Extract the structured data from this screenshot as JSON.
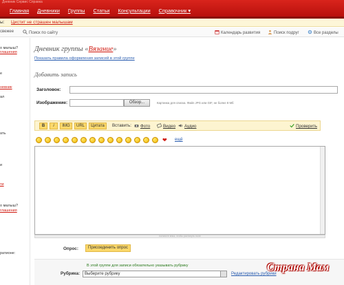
{
  "topnav": {
    "sub_text": "Дневник   Сервис   Справка",
    "items": [
      "Главная",
      "Дневники",
      "Группы",
      "Статьи",
      "Консультации"
    ],
    "dropdown": "Справочник"
  },
  "promo": {
    "left": "ы:",
    "text": "Цистит не страшен малышам"
  },
  "toolbar": {
    "left": "свежее",
    "search": "Поиск по сайту",
    "calendar": "Календарь развития",
    "friends": "Поиск подруг",
    "sections": "Все разделы"
  },
  "sidebar": {
    "t1": "о малыш?",
    "l1": "глашения",
    "t2": "е",
    "l2": "невник",
    "t3": "ал",
    "t4": "ать",
    "t5": "и",
    "l3": "ти",
    "t6": "о малыш?",
    "l4": "глашения",
    "t7": "ратионе:"
  },
  "page": {
    "title_prefix": "Дневник группы «",
    "group": "Вязание",
    "title_suffix": "»",
    "rules_link": "Показать правила оформления записей в этой группе",
    "add_heading": "Добавить запись"
  },
  "form": {
    "title_label": "Заголовок:",
    "image_label": "Изображение:",
    "browse": "Обзор...",
    "image_hint": "Картинка для списка. Файл JPG или GIF, не более 8 Мб"
  },
  "editor": {
    "bold": "B",
    "italic": "i",
    "img": "IMG",
    "url": "URL",
    "quote": "Цитата",
    "insert": "Вставить:",
    "photo": "Фото",
    "video": "Видео",
    "audio": "Аудио",
    "check": "Проверить",
    "more": "ещё",
    "resize": "потяните вниз, чтобы растянуть поле"
  },
  "poll": {
    "label": "Опрос:",
    "button": "Присоединить опрос"
  },
  "rubric": {
    "note": "В этой группе для записи обязательно указывать рубрику",
    "label": "Рубрика:",
    "selected": "Выберите рубрику",
    "edit": "Редактировать рубрики"
  },
  "logo": {
    "text": "Страна Мам"
  },
  "colors": {
    "brand_red": "#d0190f",
    "link_blue": "#2a5db0",
    "button_yellow": "#fbd86a"
  }
}
